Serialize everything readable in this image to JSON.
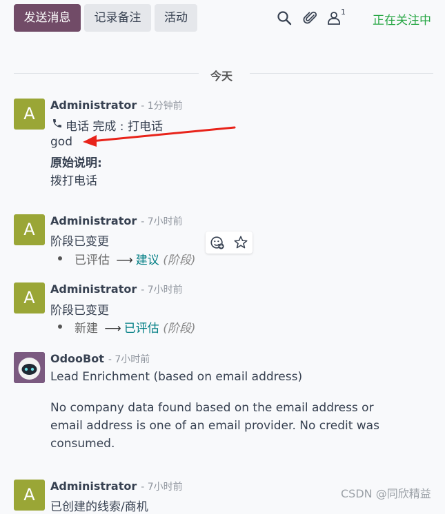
{
  "toolbar": {
    "send_message_label": "发送消息",
    "log_note_label": "记录备注",
    "activity_label": "活动",
    "follower_count": "1",
    "following_label": "正在关注中"
  },
  "divider": {
    "label": "今天"
  },
  "messages": [
    {
      "avatar_letter": "A",
      "author": "Administrator",
      "time": "- 1分钟前",
      "activity_line": "电话 完成 : 打电话",
      "body": "god",
      "original_label": "原始说明:",
      "original_text": "拨打电话"
    },
    {
      "avatar_letter": "A",
      "author": "Administrator",
      "time": "- 7小时前",
      "body": "阶段已变更",
      "old_value": "已评估",
      "new_value": "建议",
      "field": "(阶段)"
    },
    {
      "avatar_letter": "A",
      "author": "Administrator",
      "time": "- 7小时前",
      "body": "阶段已变更",
      "old_value": "新建",
      "new_value": "已评估",
      "field": "(阶段)"
    },
    {
      "author": "OdooBot",
      "time": "- 7小时前",
      "title": "Lead Enrichment (based on email address)",
      "body_lines": [
        "No company data found based on the email address or",
        "email address is one of an email provider. No credit was",
        "consumed."
      ]
    },
    {
      "avatar_letter": "A",
      "author": "Administrator",
      "time": "- 7小时前",
      "body": "已创建的线索/商机"
    }
  ],
  "watermark": "CSDN @同欣精益",
  "colors": {
    "primary": "#714b67",
    "following": "#28a745",
    "link": "#017e84",
    "avatar": "#9aa636",
    "annotation_arrow": "#e8231a"
  }
}
